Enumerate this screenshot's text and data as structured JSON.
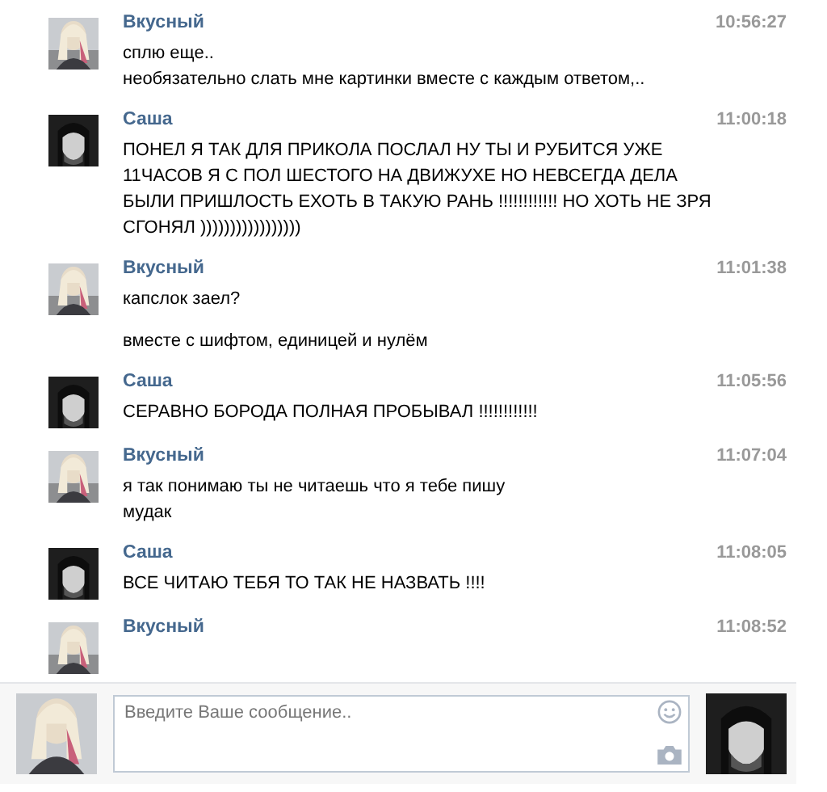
{
  "messages": [
    {
      "sender": "Вкусный",
      "time": "10:56:27",
      "kind": "light",
      "blocks": [
        [
          "сплю еще..",
          "необязательно слать мне картинки вместе с каждым ответом,.."
        ]
      ]
    },
    {
      "sender": "Саша",
      "time": "11:00:18",
      "kind": "dark",
      "blocks": [
        [
          "ПОНЕЛ Я ТАК ДЛЯ ПРИКОЛА ПОСЛАЛ НУ ТЫ И РУБИТСЯ УЖЕ 11ЧАСОВ Я С ПОЛ ШЕСТОГО НА ДВИЖУХЕ НО НЕВСЕГДА ДЕЛА БЫЛИ ПРИШЛОСТЬ ЕХОТЬ В ТАКУЮ РАНЬ !!!!!!!!!!!! НО ХОТЬ НЕ ЗРЯ СГОНЯЛ )))))))))))))))))"
        ]
      ]
    },
    {
      "sender": "Вкусный",
      "time": "11:01:38",
      "kind": "light",
      "blocks": [
        [
          "капслок заел?"
        ],
        [
          "вместе с шифтом, единицей и нулём"
        ]
      ]
    },
    {
      "sender": "Саша",
      "time": "11:05:56",
      "kind": "dark",
      "blocks": [
        [
          "СЕРАВНО БОРОДА ПОЛНАЯ ПРОБЫВАЛ !!!!!!!!!!!!"
        ]
      ]
    },
    {
      "sender": "Вкусный",
      "time": "11:07:04",
      "kind": "light",
      "blocks": [
        [
          "я так понимаю ты не читаешь что я тебе пишу",
          "мудак"
        ]
      ]
    },
    {
      "sender": "Саша",
      "time": "11:08:05",
      "kind": "dark",
      "blocks": [
        [
          "ВСЕ ЧИТАЮ ТЕБЯ ТО ТАК НЕ НАЗВАТЬ !!!!"
        ]
      ]
    },
    {
      "sender": "Вкусный",
      "time": "11:08:52",
      "kind": "light"
    }
  ],
  "composer": {
    "placeholder": "Введите Ваше сообщение..",
    "avatars": [
      {
        "kind": "light"
      },
      {
        "kind": "dark"
      }
    ]
  }
}
